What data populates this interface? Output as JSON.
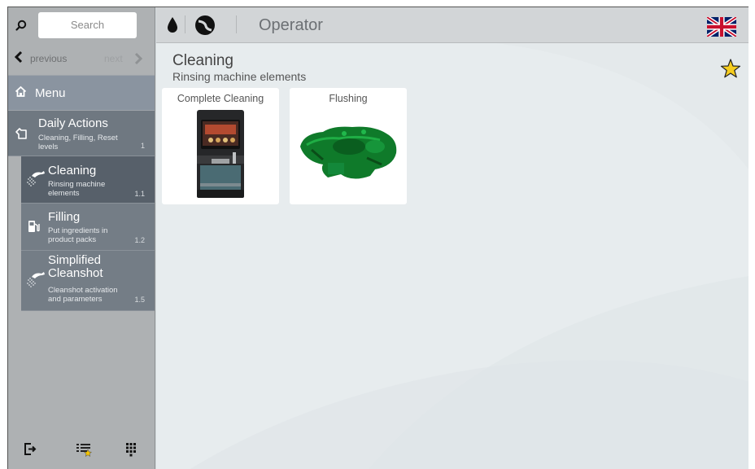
{
  "search": {
    "placeholder": "Search"
  },
  "pager": {
    "previous": "previous",
    "next": "next"
  },
  "menu": {
    "label": "Menu"
  },
  "daily_actions": {
    "title": "Daily Actions",
    "subtitle": "Cleaning, Filling, Reset levels",
    "number": "1"
  },
  "subitems": [
    {
      "title": "Cleaning",
      "desc": "Rinsing machine elements",
      "number": "1.1",
      "icon": "rinse-icon",
      "active": true
    },
    {
      "title": "Filling",
      "desc": "Put ingredients in product packs",
      "number": "1.2",
      "icon": "fuel-pump-icon",
      "active": false
    },
    {
      "title": "Simplified Cleanshot",
      "desc": "Cleanshot activation and parameters",
      "number": "1.5",
      "icon": "rinse-icon",
      "active": false
    }
  ],
  "footer_icons": [
    "logout-icon",
    "favorites-list-icon",
    "keypad-icon"
  ],
  "topbar": {
    "title": "Operator",
    "icons": [
      "water-drop-icon",
      "coffee-bean-icon",
      "uk-flag-icon"
    ]
  },
  "page": {
    "title": "Cleaning",
    "subtitle": "Rinsing machine elements"
  },
  "cards": [
    {
      "label": "Complete Cleaning",
      "image": "coffee-machine-image"
    },
    {
      "label": "Flushing",
      "image": "brewing-unit-image"
    }
  ],
  "colors": {
    "sidebar": "#aeb1b3",
    "menu": "#8a94a0",
    "active_item": "#57606a",
    "topbar": "#d2d5d7",
    "accent_green": "#0f8a2e"
  }
}
